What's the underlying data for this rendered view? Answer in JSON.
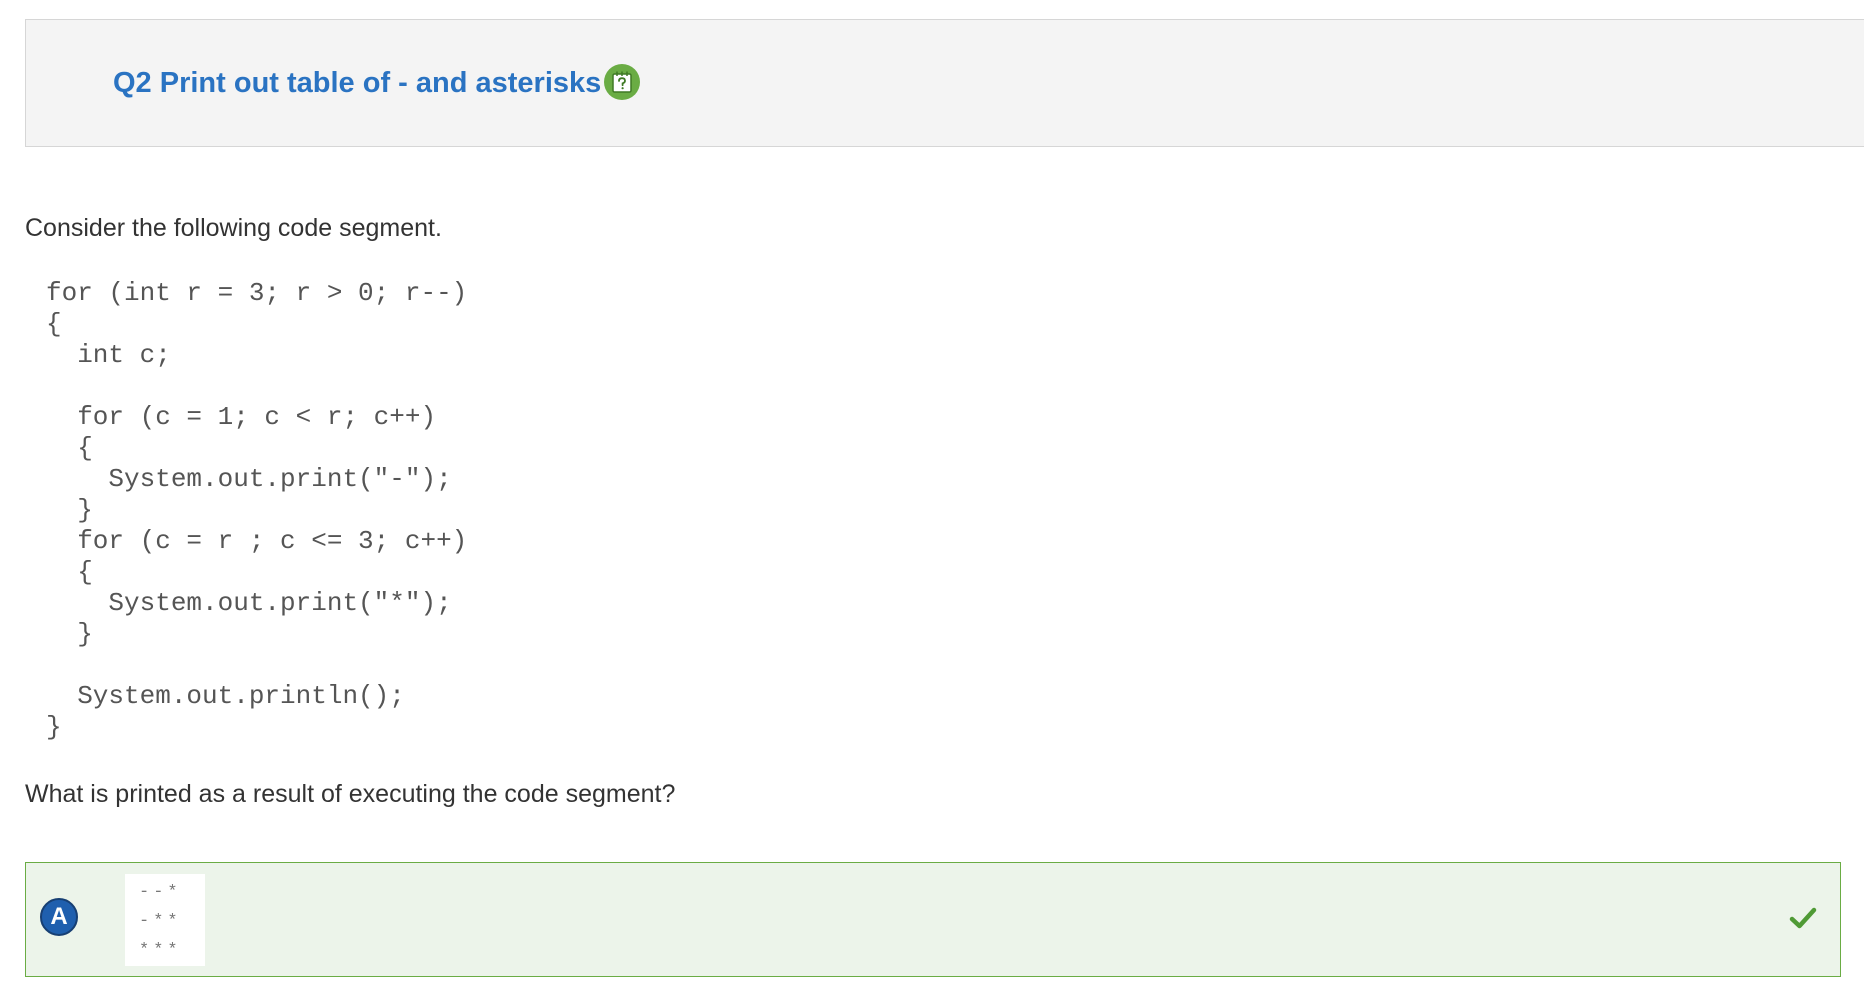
{
  "question": {
    "title": "Q2 Print out table of - and asterisks",
    "help_icon": "help-notepad-icon",
    "prompt": "Consider the following code segment.",
    "code_lines": [
      "for (int r = 3; r > 0; r--)",
      "{",
      "  int c;",
      "",
      "  for (c = 1; c < r; c++)",
      "  {",
      "    System.out.print(\"-\");",
      "  }",
      "  for (c = r ; c <= 3; c++)",
      "  {",
      "    System.out.print(\"*\");",
      "  }",
      "",
      "  System.out.println();",
      "}"
    ],
    "ask": "What is printed as a result of executing the code segment?"
  },
  "answers": [
    {
      "letter": "A",
      "output_lines": [
        "--*",
        "-**",
        "***"
      ],
      "status_icon": "check-icon",
      "correct": true
    }
  ],
  "colors": {
    "title": "#2a73c2",
    "help_icon_bg": "#6aac44",
    "correct_border": "#6aac44",
    "correct_bg": "#ecf4ea",
    "letter_badge": "#1f5fae"
  }
}
